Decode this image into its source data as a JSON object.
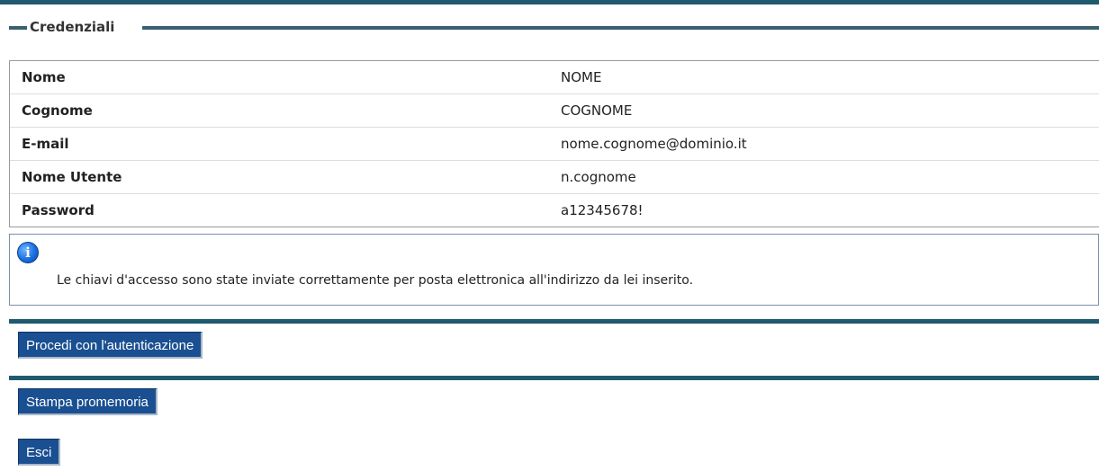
{
  "fieldset": {
    "legend": "Credenziali"
  },
  "credentials": {
    "rows": [
      {
        "label": "Nome",
        "value": "NOME"
      },
      {
        "label": "Cognome",
        "value": "COGNOME"
      },
      {
        "label": "E-mail",
        "value": "nome.cognome@dominio.it"
      },
      {
        "label": "Nome Utente",
        "value": "n.cognome"
      },
      {
        "label": "Password",
        "value": "a12345678!"
      }
    ]
  },
  "info": {
    "icon": "info-icon",
    "icon_glyph": "i",
    "message": "Le chiavi d'accesso sono state inviate correttamente per posta elettronica all'indirizzo da lei inserito."
  },
  "buttons": {
    "proceed": "Procedi con l'autenticazione",
    "print": "Stampa promemoria",
    "exit": "Esci"
  },
  "colors": {
    "accent_bar": "#1f5a6e",
    "button_bg": "#1a4f91",
    "info_border": "#7a8fa8"
  }
}
